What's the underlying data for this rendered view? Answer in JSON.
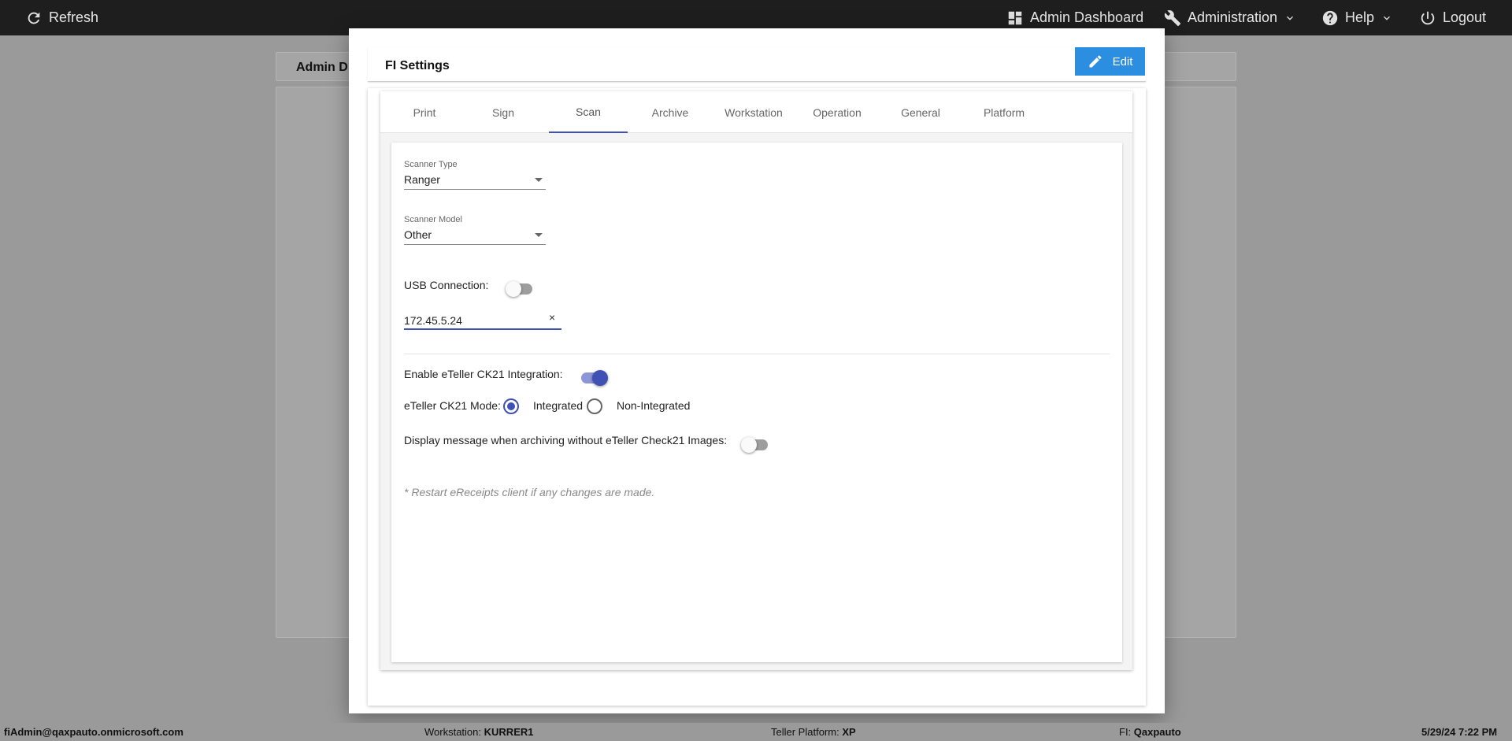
{
  "topbar": {
    "refresh_label": "Refresh",
    "admin_dashboard_label": "Admin Dashboard",
    "administration_label": "Administration",
    "help_label": "Help",
    "logout_label": "Logout"
  },
  "background": {
    "header_title": "Admin D"
  },
  "modal": {
    "title": "FI Settings",
    "edit_label": "Edit",
    "tabs": [
      {
        "label": "Print"
      },
      {
        "label": "Sign"
      },
      {
        "label": "Scan"
      },
      {
        "label": "Archive"
      },
      {
        "label": "Workstation"
      },
      {
        "label": "Operation"
      },
      {
        "label": "General"
      },
      {
        "label": "Platform"
      }
    ],
    "active_tab": "Scan",
    "scan": {
      "scanner_type_label": "Scanner Type",
      "scanner_type_value": "Ranger",
      "scanner_model_label": "Scanner Model",
      "scanner_model_value": "Other",
      "usb_connection_label": "USB Connection:",
      "usb_connection_on": false,
      "ip_address_value": "172.45.5.24",
      "clear_icon": "×",
      "ck21_integration_label": "Enable eTeller CK21 Integration:",
      "ck21_integration_on": true,
      "ck21_mode_label": "eTeller CK21 Mode:",
      "ck21_mode_options": [
        {
          "label": "Integrated",
          "checked": true
        },
        {
          "label": "Non-Integrated",
          "checked": false
        }
      ],
      "display_message_label": "Display message when archiving without eTeller Check21 Images:",
      "display_message_on": false,
      "restart_note": "* Restart eReceipts client if any changes are made."
    }
  },
  "statusbar": {
    "user": "fiAdmin@qaxpauto.onmicrosoft.com",
    "workstation_label": "Workstation:",
    "workstation_value": "KURRER1",
    "teller_platform_label": "Teller Platform:",
    "teller_platform_value": "XP",
    "fi_label": "FI:",
    "fi_value": "Qaxpauto",
    "datetime": "5/29/24 7:22 PM"
  },
  "colors": {
    "accent": "#3f51b5",
    "edit_button": "#2c8ee0",
    "topbar": "#1e1e1e"
  }
}
